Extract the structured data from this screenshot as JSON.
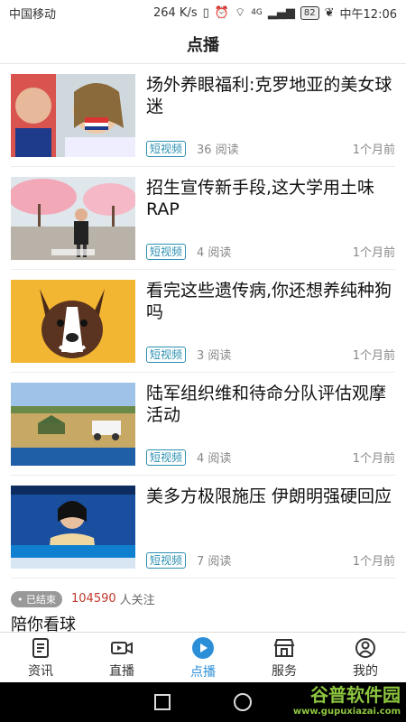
{
  "status": {
    "carrier": "中国移动",
    "speed": "264 K/s",
    "network": "4G",
    "battery": "82",
    "time": "中午12:06"
  },
  "header": {
    "title": "点播"
  },
  "items": [
    {
      "title": "场外养眼福利:克罗地亚的美女球迷",
      "tag": "短视频",
      "reads": "36 阅读",
      "time": "1个月前"
    },
    {
      "title": "招生宣传新手段,这大学用土味RAP",
      "tag": "短视频",
      "reads": "4 阅读",
      "time": "1个月前"
    },
    {
      "title": "看完这些遗传病,你还想养纯种狗吗",
      "tag": "短视频",
      "reads": "3 阅读",
      "time": "1个月前"
    },
    {
      "title": "陆军组织维和待命分队评估观摩活动",
      "tag": "短视频",
      "reads": "4 阅读",
      "time": "1个月前"
    },
    {
      "title": "美多方极限施压 伊朗明强硬回应",
      "tag": "短视频",
      "reads": "7 阅读",
      "time": "1个月前"
    }
  ],
  "live": {
    "badge": "• 已结束",
    "count": "104590",
    "follow_text": "人关注",
    "title": "陪你看球"
  },
  "tabs": [
    {
      "label": "资讯",
      "icon": "news-icon",
      "active": false
    },
    {
      "label": "直播",
      "icon": "video-camera-icon",
      "active": false
    },
    {
      "label": "点播",
      "icon": "play-circle-icon",
      "active": true
    },
    {
      "label": "服务",
      "icon": "store-icon",
      "active": false
    },
    {
      "label": "我的",
      "icon": "user-icon",
      "active": false
    }
  ],
  "watermark": {
    "line1": "谷普软件园",
    "line2": "www.gupuxiazai.com"
  },
  "colors": {
    "accent": "#2b8fd8",
    "tag": "#2b8fb0",
    "count": "#c0392b"
  }
}
